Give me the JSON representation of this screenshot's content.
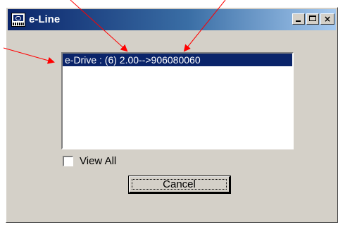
{
  "window": {
    "title": "e-Line",
    "title_bar_gradient": [
      "#0a246a",
      "#a6caf0"
    ],
    "controls": {
      "minimize": "minimize-icon",
      "maximize": "maximize-icon",
      "close": "close-icon",
      "close_glyph": "×"
    }
  },
  "list": {
    "items": [
      {
        "label": "e-Drive : (6) 2.00-->906080060",
        "selected": true
      }
    ],
    "selection_color": "#0a246a"
  },
  "view_all": {
    "label": "View All",
    "checked": false
  },
  "buttons": {
    "cancel_label": "Cancel"
  },
  "annotations": {
    "arrow_color": "#ff0000",
    "count": 3
  }
}
